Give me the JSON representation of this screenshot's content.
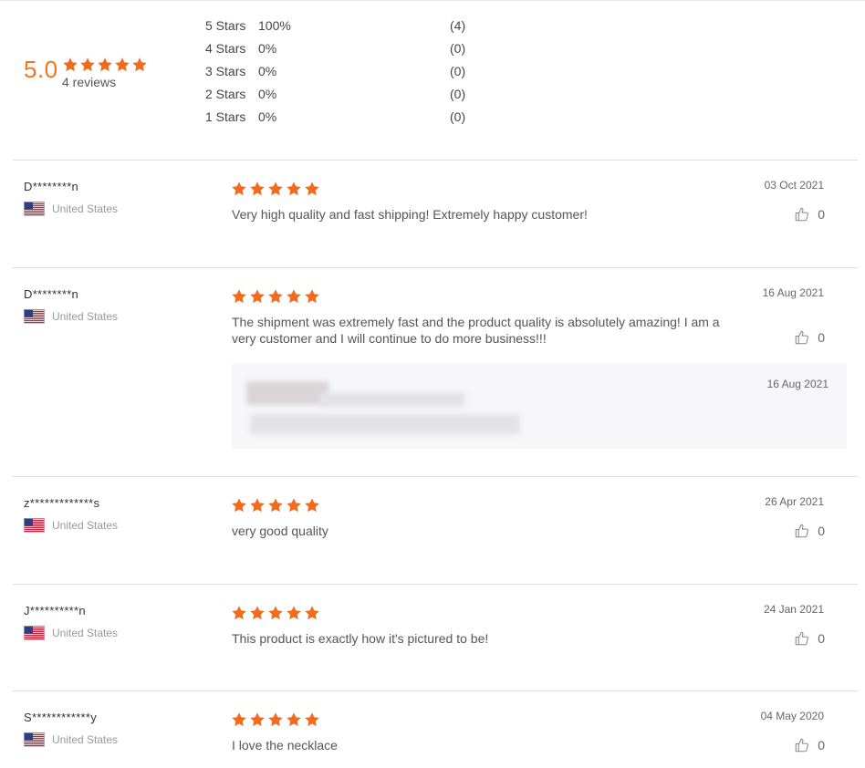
{
  "summary": {
    "average": "5.0",
    "rating_stars": 5,
    "review_count": "4 reviews",
    "distribution": [
      {
        "label": "5 Stars",
        "percent": "100%",
        "count": "(4)"
      },
      {
        "label": "4 Stars",
        "percent": "0%",
        "count": "(0)"
      },
      {
        "label": "3 Stars",
        "percent": "0%",
        "count": "(0)"
      },
      {
        "label": "2 Stars",
        "percent": "0%",
        "count": "(0)"
      },
      {
        "label": "1 Stars",
        "percent": "0%",
        "count": "(0)"
      }
    ]
  },
  "reviews": [
    {
      "name": "D********n",
      "country": "United States",
      "stars": 5,
      "date": "03 Oct 2021",
      "text": "Very high quality and fast shipping! Extremely happy customer!",
      "likes": "0"
    },
    {
      "name": "D********n",
      "country": "United States",
      "stars": 5,
      "date": "16 Aug 2021",
      "text": "The shipment was extremely fast and the product quality is absolutely amazing! I am a very customer and I will continue to do more business!!!",
      "likes": "0",
      "reply": {
        "date": "16 Aug 2021"
      }
    },
    {
      "name": "z*************s",
      "country": "United States",
      "stars": 5,
      "date": "26 Apr 2021",
      "text": "very good quality",
      "likes": "0"
    },
    {
      "name": "J**********n",
      "country": "United States",
      "stars": 5,
      "date": "24 Jan 2021",
      "text": "This product is exactly how it's pictured to be!",
      "likes": "0"
    },
    {
      "name": "S************y",
      "country": "United States",
      "stars": 5,
      "date": "04 May 2020",
      "text": "I love the necklace",
      "likes": "0"
    }
  ],
  "icons": {
    "star": "star-icon",
    "flag": "us-flag-icon",
    "like": "thumbs-up-icon"
  },
  "colors": {
    "accent": "#f0771f",
    "star": "#f26a1b"
  }
}
